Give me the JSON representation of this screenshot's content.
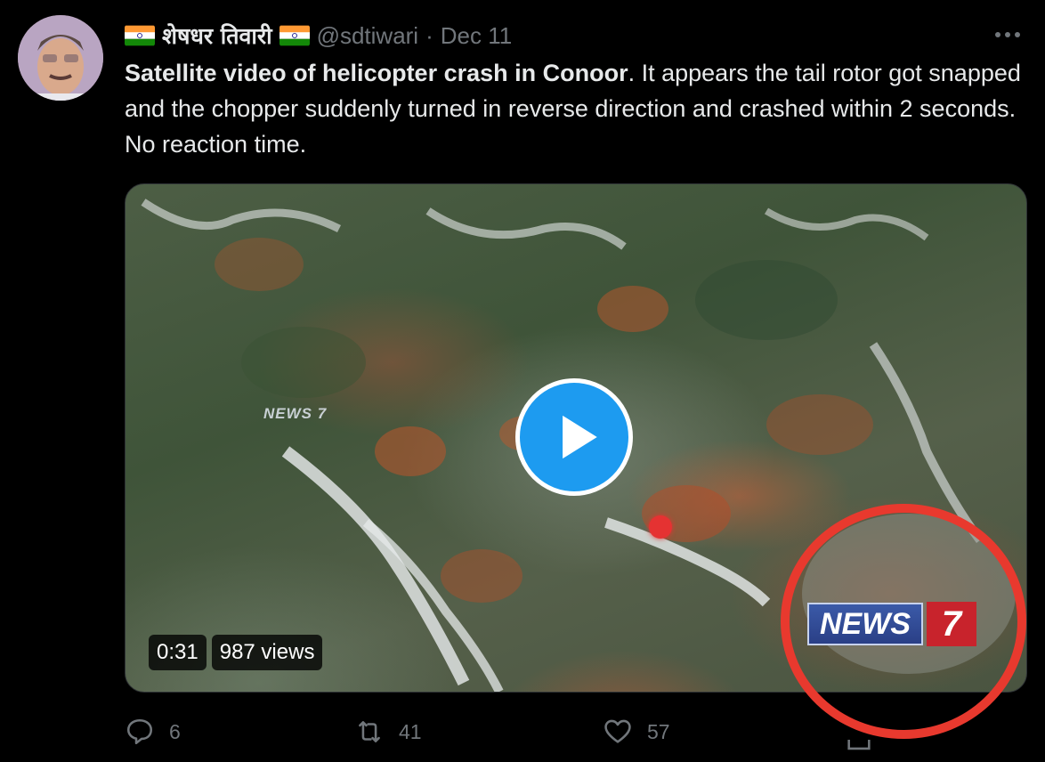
{
  "user": {
    "display_name": "शेषधर तिवारी",
    "handle": "@sdtiwari",
    "separator": "·",
    "date": "Dec 11"
  },
  "tweet": {
    "bold_text": "Satellite video of helicopter crash in Conoor",
    "rest_text": ". It appears the tail rotor got snapped and the chopper suddenly turned in reverse direction and crashed within 2 seconds. No reaction time."
  },
  "media": {
    "duration": "0:31",
    "views": "987 views",
    "watermark_small": "NEWS 7",
    "watermark_news": "NEWS",
    "watermark_seven": "7"
  },
  "actions": {
    "reply_count": "6",
    "retweet_count": "41",
    "like_count": "57"
  },
  "icons": {
    "more": "more-icon",
    "play": "play-icon",
    "reply": "reply-icon",
    "retweet": "retweet-icon",
    "like": "heart-icon",
    "share": "share-icon",
    "flag": "india-flag-icon"
  },
  "colors": {
    "background": "#000000",
    "text": "#e7e9ea",
    "secondary": "#71767b",
    "accent": "#1d9bf0",
    "annotation": "#e8392e"
  }
}
